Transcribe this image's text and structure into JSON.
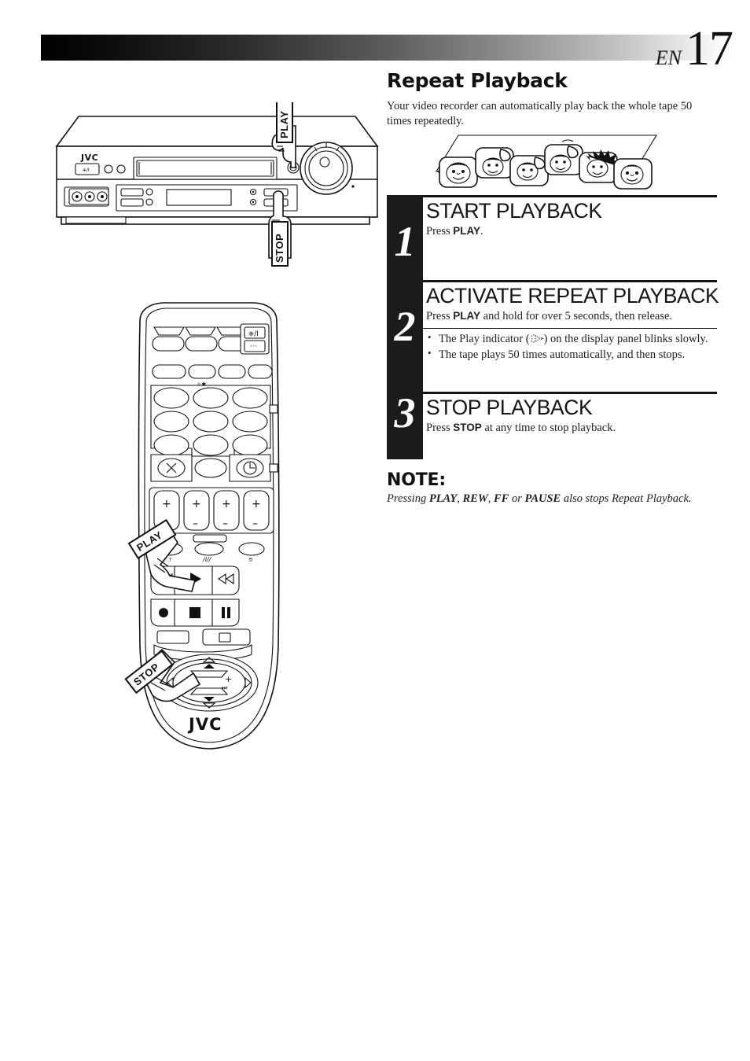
{
  "page": {
    "language_code": "EN",
    "page_number": "17"
  },
  "section": {
    "title": "Repeat Playback",
    "intro": "Your video recorder can automatically play back the whole tape 50 times repeatedly."
  },
  "illustrations": {
    "vcr": {
      "brand": "JVC",
      "callouts": [
        {
          "label": "PLAY",
          "name": "vcr-play-callout"
        },
        {
          "label": "STOP",
          "name": "vcr-stop-callout"
        }
      ]
    },
    "remote": {
      "brand": "JVC",
      "callouts": [
        {
          "label": "PLAY",
          "name": "remote-play-callout"
        },
        {
          "label": "STOP",
          "name": "remote-stop-callout"
        }
      ]
    },
    "repeat_tape": {
      "description": "Filmstrip of repeating cartoon face frames"
    }
  },
  "steps": [
    {
      "number": "1",
      "heading": "START PLAYBACK",
      "instruction_pre": "Press ",
      "instruction_key": "PLAY",
      "instruction_post": "."
    },
    {
      "number": "2",
      "heading": "ACTIVATE REPEAT PLAYBACK",
      "instruction_pre": "Press ",
      "instruction_key": "PLAY",
      "instruction_post": " and hold for over 5 seconds, then release.",
      "bullets": [
        {
          "pre": "The Play indicator (",
          "icon": "play-indicator-icon",
          "post": ") on the display panel blinks slowly."
        },
        {
          "pre": "The tape plays 50 times automatically, and then stops.",
          "icon": null,
          "post": ""
        }
      ]
    },
    {
      "number": "3",
      "heading": "STOP PLAYBACK",
      "instruction_pre": "Press ",
      "instruction_key": "STOP",
      "instruction_post": " at any time to stop playback."
    }
  ],
  "note": {
    "title": "NOTE:",
    "pre": "Pressing ",
    "keys": [
      "PLAY",
      "REW",
      "FF",
      "PAUSE"
    ],
    "sep1": ", ",
    "sep2": ", ",
    "sep3": " or ",
    "post": " also stops Repeat Playback."
  },
  "colors": {
    "ink": "#1a1a1a",
    "step_bar": "#1c1a1a",
    "paper": "#ffffff"
  }
}
